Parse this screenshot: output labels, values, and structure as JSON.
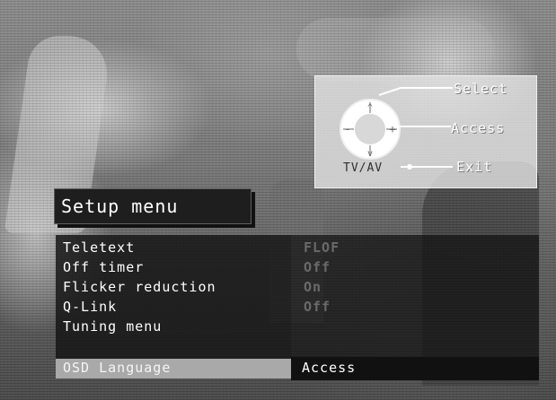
{
  "help": {
    "select_label": "Select",
    "access_label": "Access",
    "exit_label": "Exit",
    "tvav_label": "TV/AV",
    "dpad_up": "^",
    "dpad_down": "v",
    "dpad_left": "-",
    "dpad_right": "+"
  },
  "menu": {
    "title": "Setup menu",
    "items": [
      {
        "label": "Teletext",
        "value": "FLOF"
      },
      {
        "label": "Off timer",
        "value": "Off"
      },
      {
        "label": "Flicker reduction",
        "value": "On"
      },
      {
        "label": "Q-Link",
        "value": "Off"
      },
      {
        "label": "Tuning menu",
        "value": ""
      },
      {
        "label": "OSD Language",
        "value": ""
      }
    ],
    "selected_index": 5,
    "action_label": "Access"
  },
  "colors": {
    "menu_bg": "#1e1e1e",
    "selection": "#a9a9a9",
    "help_panel": "#e1e1e1"
  }
}
